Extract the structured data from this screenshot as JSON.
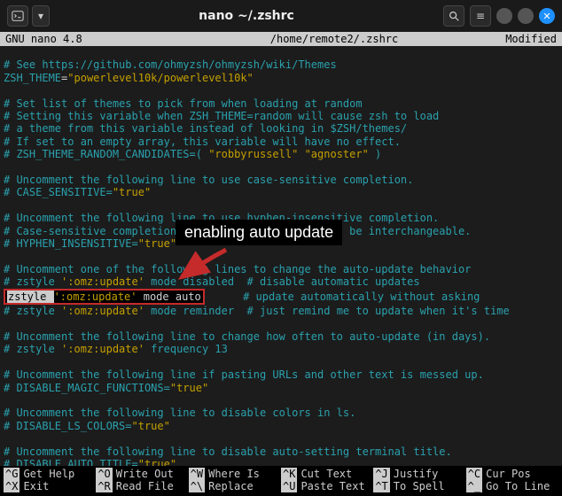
{
  "titlebar": {
    "title": "nano ~/.zshrc"
  },
  "header": {
    "left": "GNU nano 4.8",
    "mid": "/home/remote2/.zshrc",
    "right": "Modified"
  },
  "annotation": {
    "label": "enabling auto update"
  },
  "lines": {
    "l1a": "# See https://github.com/ohmyzsh/ohmyzsh/wiki/Themes",
    "l2_var": "ZSH_THEME",
    "l2_val": "\"powerlevel10k/powerlevel10k\"",
    "l3": "",
    "l4": "# Set list of themes to pick from when loading at random",
    "l5": "# Setting this variable when ZSH_THEME=random will cause zsh to load",
    "l6": "# a theme from this variable instead of looking in $ZSH/themes/",
    "l7": "# If set to an empty array, this variable will have no effect.",
    "l8_pre": "# ZSH_THEME_RANDOM_CANDIDATES=( ",
    "l8_s1": "\"robbyrussell\"",
    "l8_s2": "\"agnoster\"",
    "l8_post": " )",
    "l9": "",
    "l10": "# Uncomment the following line to use case-sensitive completion.",
    "l11_pre": "# CASE_SENSITIVE=",
    "l11_val": "\"true\"",
    "l12": "",
    "l13": "# Uncomment the following line to use hyphen-insensitive completion.",
    "l14": "# Case-sensitive completion must be off. _ and - will be interchangeable.",
    "l15_pre": "# HYPHEN_INSENSITIVE=",
    "l15_val": "\"true\"",
    "l16": "",
    "l17": "# Uncomment one of the following lines to change the auto-update behavior",
    "l18_pre": "# zstyle ",
    "l18_s": "':omz:update'",
    "l18_post": " mode disabled  # disable automatic updates",
    "l19_cmd": "zstyle ",
    "l19_s": "':omz:update'",
    "l19_post": " mode auto",
    "l19_comment": "      # update automatically without asking",
    "l20_pre": "# zstyle ",
    "l20_s": "':omz:update'",
    "l20_post": " mode reminder  # just remind me to update when it's time",
    "l21": "",
    "l22": "# Uncomment the following line to change how often to auto-update (in days).",
    "l23_pre": "# zstyle ",
    "l23_s": "':omz:update'",
    "l23_post": " frequency 13",
    "l24": "",
    "l25": "# Uncomment the following line if pasting URLs and other text is messed up.",
    "l26_pre": "# DISABLE_MAGIC_FUNCTIONS=",
    "l26_val": "\"true\"",
    "l27": "",
    "l28": "# Uncomment the following line to disable colors in ls.",
    "l29_pre": "# DISABLE_LS_COLORS=",
    "l29_val": "\"true\"",
    "l30": "",
    "l31": "# Uncomment the following line to disable auto-setting terminal title.",
    "l32_pre": "# DISABLE_AUTO_TITLE=",
    "l32_val": "\"true\""
  },
  "shortcuts": {
    "r1": [
      {
        "key": "^G",
        "label": "Get Help"
      },
      {
        "key": "^O",
        "label": "Write Out"
      },
      {
        "key": "^W",
        "label": "Where Is"
      },
      {
        "key": "^K",
        "label": "Cut Text"
      },
      {
        "key": "^J",
        "label": "Justify"
      },
      {
        "key": "^C",
        "label": "Cur Pos"
      }
    ],
    "r2": [
      {
        "key": "^X",
        "label": "Exit"
      },
      {
        "key": "^R",
        "label": "Read File"
      },
      {
        "key": "^\\",
        "label": "Replace"
      },
      {
        "key": "^U",
        "label": "Paste Text"
      },
      {
        "key": "^T",
        "label": "To Spell"
      },
      {
        "key": "^_",
        "label": "Go To Line"
      }
    ]
  }
}
